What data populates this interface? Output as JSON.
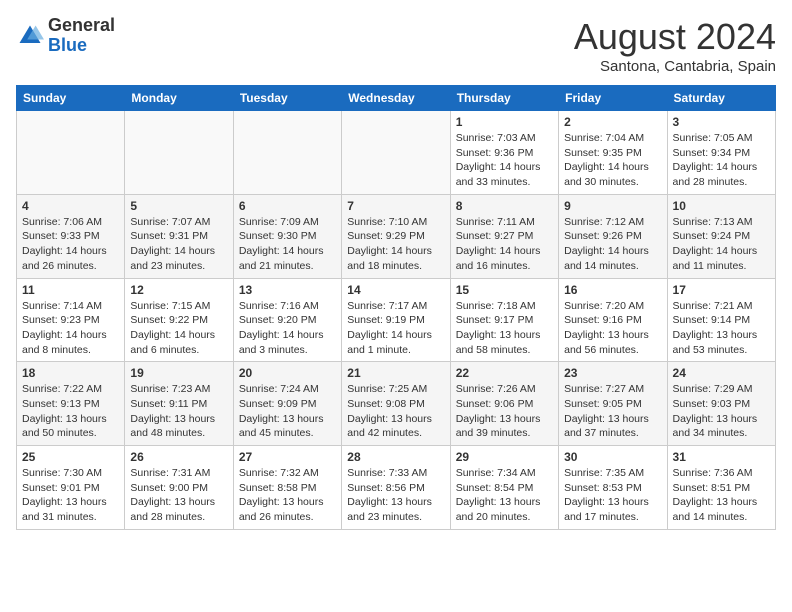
{
  "header": {
    "logo_general": "General",
    "logo_blue": "Blue",
    "month_year": "August 2024",
    "location": "Santona, Cantabria, Spain"
  },
  "weekdays": [
    "Sunday",
    "Monday",
    "Tuesday",
    "Wednesday",
    "Thursday",
    "Friday",
    "Saturday"
  ],
  "weeks": [
    [
      {
        "day": "",
        "info": ""
      },
      {
        "day": "",
        "info": ""
      },
      {
        "day": "",
        "info": ""
      },
      {
        "day": "",
        "info": ""
      },
      {
        "day": "1",
        "info": "Sunrise: 7:03 AM\nSunset: 9:36 PM\nDaylight: 14 hours\nand 33 minutes."
      },
      {
        "day": "2",
        "info": "Sunrise: 7:04 AM\nSunset: 9:35 PM\nDaylight: 14 hours\nand 30 minutes."
      },
      {
        "day": "3",
        "info": "Sunrise: 7:05 AM\nSunset: 9:34 PM\nDaylight: 14 hours\nand 28 minutes."
      }
    ],
    [
      {
        "day": "4",
        "info": "Sunrise: 7:06 AM\nSunset: 9:33 PM\nDaylight: 14 hours\nand 26 minutes."
      },
      {
        "day": "5",
        "info": "Sunrise: 7:07 AM\nSunset: 9:31 PM\nDaylight: 14 hours\nand 23 minutes."
      },
      {
        "day": "6",
        "info": "Sunrise: 7:09 AM\nSunset: 9:30 PM\nDaylight: 14 hours\nand 21 minutes."
      },
      {
        "day": "7",
        "info": "Sunrise: 7:10 AM\nSunset: 9:29 PM\nDaylight: 14 hours\nand 18 minutes."
      },
      {
        "day": "8",
        "info": "Sunrise: 7:11 AM\nSunset: 9:27 PM\nDaylight: 14 hours\nand 16 minutes."
      },
      {
        "day": "9",
        "info": "Sunrise: 7:12 AM\nSunset: 9:26 PM\nDaylight: 14 hours\nand 14 minutes."
      },
      {
        "day": "10",
        "info": "Sunrise: 7:13 AM\nSunset: 9:24 PM\nDaylight: 14 hours\nand 11 minutes."
      }
    ],
    [
      {
        "day": "11",
        "info": "Sunrise: 7:14 AM\nSunset: 9:23 PM\nDaylight: 14 hours\nand 8 minutes."
      },
      {
        "day": "12",
        "info": "Sunrise: 7:15 AM\nSunset: 9:22 PM\nDaylight: 14 hours\nand 6 minutes."
      },
      {
        "day": "13",
        "info": "Sunrise: 7:16 AM\nSunset: 9:20 PM\nDaylight: 14 hours\nand 3 minutes."
      },
      {
        "day": "14",
        "info": "Sunrise: 7:17 AM\nSunset: 9:19 PM\nDaylight: 14 hours\nand 1 minute."
      },
      {
        "day": "15",
        "info": "Sunrise: 7:18 AM\nSunset: 9:17 PM\nDaylight: 13 hours\nand 58 minutes."
      },
      {
        "day": "16",
        "info": "Sunrise: 7:20 AM\nSunset: 9:16 PM\nDaylight: 13 hours\nand 56 minutes."
      },
      {
        "day": "17",
        "info": "Sunrise: 7:21 AM\nSunset: 9:14 PM\nDaylight: 13 hours\nand 53 minutes."
      }
    ],
    [
      {
        "day": "18",
        "info": "Sunrise: 7:22 AM\nSunset: 9:13 PM\nDaylight: 13 hours\nand 50 minutes."
      },
      {
        "day": "19",
        "info": "Sunrise: 7:23 AM\nSunset: 9:11 PM\nDaylight: 13 hours\nand 48 minutes."
      },
      {
        "day": "20",
        "info": "Sunrise: 7:24 AM\nSunset: 9:09 PM\nDaylight: 13 hours\nand 45 minutes."
      },
      {
        "day": "21",
        "info": "Sunrise: 7:25 AM\nSunset: 9:08 PM\nDaylight: 13 hours\nand 42 minutes."
      },
      {
        "day": "22",
        "info": "Sunrise: 7:26 AM\nSunset: 9:06 PM\nDaylight: 13 hours\nand 39 minutes."
      },
      {
        "day": "23",
        "info": "Sunrise: 7:27 AM\nSunset: 9:05 PM\nDaylight: 13 hours\nand 37 minutes."
      },
      {
        "day": "24",
        "info": "Sunrise: 7:29 AM\nSunset: 9:03 PM\nDaylight: 13 hours\nand 34 minutes."
      }
    ],
    [
      {
        "day": "25",
        "info": "Sunrise: 7:30 AM\nSunset: 9:01 PM\nDaylight: 13 hours\nand 31 minutes."
      },
      {
        "day": "26",
        "info": "Sunrise: 7:31 AM\nSunset: 9:00 PM\nDaylight: 13 hours\nand 28 minutes."
      },
      {
        "day": "27",
        "info": "Sunrise: 7:32 AM\nSunset: 8:58 PM\nDaylight: 13 hours\nand 26 minutes."
      },
      {
        "day": "28",
        "info": "Sunrise: 7:33 AM\nSunset: 8:56 PM\nDaylight: 13 hours\nand 23 minutes."
      },
      {
        "day": "29",
        "info": "Sunrise: 7:34 AM\nSunset: 8:54 PM\nDaylight: 13 hours\nand 20 minutes."
      },
      {
        "day": "30",
        "info": "Sunrise: 7:35 AM\nSunset: 8:53 PM\nDaylight: 13 hours\nand 17 minutes."
      },
      {
        "day": "31",
        "info": "Sunrise: 7:36 AM\nSunset: 8:51 PM\nDaylight: 13 hours\nand 14 minutes."
      }
    ]
  ]
}
